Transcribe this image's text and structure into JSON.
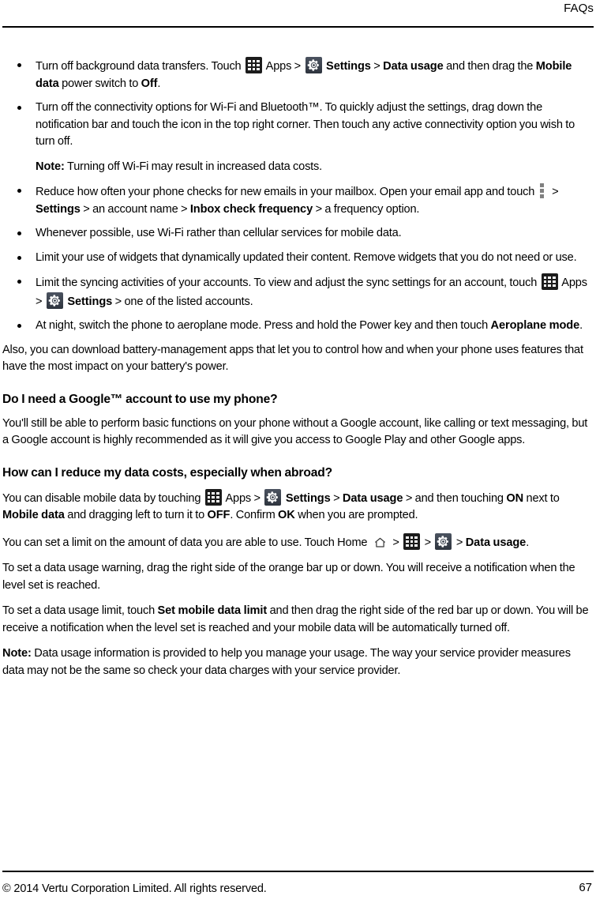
{
  "header": {
    "title": "FAQs"
  },
  "footer": {
    "copyright": "© 2014 Vertu Corporation Limited. All rights reserved.",
    "page_number": "67"
  },
  "icons": {
    "apps": "apps-grid-icon",
    "settings": "settings-gear-icon",
    "overflow": "overflow-menu-icon",
    "home": "home-icon"
  },
  "content": {
    "battery_tips": [
      {
        "id": "tip-background-data",
        "parts": [
          {
            "t": "text",
            "v": "Turn off background data transfers. Touch "
          },
          {
            "t": "icon",
            "v": "apps"
          },
          {
            "t": "text",
            "v": " Apps > "
          },
          {
            "t": "icon",
            "v": "settings"
          },
          {
            "t": "bold",
            "v": " Settings"
          },
          {
            "t": "text",
            "v": " > "
          },
          {
            "t": "bold",
            "v": "Data usage"
          },
          {
            "t": "text",
            "v": " and then drag the "
          },
          {
            "t": "bold",
            "v": "Mobile data"
          },
          {
            "t": "text",
            "v": " power switch to "
          },
          {
            "t": "bold",
            "v": "Off"
          },
          {
            "t": "text",
            "v": "."
          }
        ]
      },
      {
        "id": "tip-connectivity",
        "parts": [
          {
            "t": "text",
            "v": "Turn off the connectivity options for Wi-Fi and Bluetooth™. To quickly adjust the settings, drag down the notification bar and touch the icon in the top right corner. Then touch any active connectivity option you wish to turn off."
          }
        ],
        "note": {
          "label": "Note:",
          "text": " Turning off Wi-Fi may result in increased data costs."
        }
      },
      {
        "id": "tip-email-frequency",
        "parts": [
          {
            "t": "text",
            "v": "Reduce how often your phone checks for new emails in your mailbox. Open your email app and touch "
          },
          {
            "t": "icon",
            "v": "overflow"
          },
          {
            "t": "text",
            "v": " > "
          },
          {
            "t": "bold",
            "v": "Settings"
          },
          {
            "t": "text",
            "v": " > an account name > "
          },
          {
            "t": "bold",
            "v": "Inbox check frequency"
          },
          {
            "t": "text",
            "v": " > a frequency option."
          }
        ]
      },
      {
        "id": "tip-use-wifi",
        "parts": [
          {
            "t": "text",
            "v": "Whenever possible, use Wi-Fi rather than cellular services for mobile data."
          }
        ]
      },
      {
        "id": "tip-widgets",
        "parts": [
          {
            "t": "text",
            "v": "Limit your use of widgets that dynamically updated their content. Remove widgets that you do not need or use."
          }
        ]
      },
      {
        "id": "tip-syncing",
        "parts": [
          {
            "t": "text",
            "v": "Limit the syncing activities of your accounts. To view and adjust the sync settings for an account, touch "
          },
          {
            "t": "icon",
            "v": "apps"
          },
          {
            "t": "text",
            "v": " Apps > "
          },
          {
            "t": "icon",
            "v": "settings"
          },
          {
            "t": "bold",
            "v": " Settings"
          },
          {
            "t": "text",
            "v": " > one of the listed accounts."
          }
        ]
      },
      {
        "id": "tip-aeroplane",
        "parts": [
          {
            "t": "text",
            "v": "At night, switch the phone to aeroplane mode. Press and hold the Power key and then touch "
          },
          {
            "t": "bold",
            "v": "Aeroplane mode"
          },
          {
            "t": "text",
            "v": "."
          }
        ]
      }
    ],
    "battery_apps_paragraph": "Also, you can download battery-management apps that let you to control how and when your phone uses features that have the most impact on your battery's power.",
    "google_account": {
      "heading": "Do I need a Google™ account to use my phone?",
      "paragraph": "You'll still be able to perform basic functions on your phone without a Google account, like calling or text messaging, but a Google account is highly recommended as it will give you access to Google Play and other Google apps."
    },
    "data_costs": {
      "heading": "How can I reduce my data costs, especially when abroad?",
      "para1_parts": [
        {
          "t": "text",
          "v": "You can disable mobile data by touching "
        },
        {
          "t": "icon",
          "v": "apps"
        },
        {
          "t": "text",
          "v": " Apps > "
        },
        {
          "t": "icon",
          "v": "settings"
        },
        {
          "t": "bold",
          "v": " Settings"
        },
        {
          "t": "text",
          "v": " > "
        },
        {
          "t": "bold",
          "v": "Data usage"
        },
        {
          "t": "text",
          "v": " > and then touching "
        },
        {
          "t": "bold",
          "v": "ON"
        },
        {
          "t": "text",
          "v": " next to "
        },
        {
          "t": "bold",
          "v": "Mobile data"
        },
        {
          "t": "text",
          "v": " and dragging left to turn it to "
        },
        {
          "t": "bold",
          "v": "OFF"
        },
        {
          "t": "text",
          "v": ". Confirm "
        },
        {
          "t": "bold",
          "v": "OK"
        },
        {
          "t": "text",
          "v": " when you are prompted."
        }
      ],
      "para2_parts": [
        {
          "t": "text",
          "v": "You can set a limit on the amount of data you are able to use. Touch Home "
        },
        {
          "t": "icon",
          "v": "home"
        },
        {
          "t": "text",
          "v": " > "
        },
        {
          "t": "icon",
          "v": "apps"
        },
        {
          "t": "text",
          "v": " > "
        },
        {
          "t": "icon",
          "v": "settings"
        },
        {
          "t": "text",
          "v": " > "
        },
        {
          "t": "bold",
          "v": "Data usage"
        },
        {
          "t": "text",
          "v": "."
        }
      ],
      "para3": "To set a data usage warning, drag the right side of the orange bar up or down. You will receive a notification when the level set is reached.",
      "para4_parts": [
        {
          "t": "text",
          "v": "To set a data usage limit, touch "
        },
        {
          "t": "bold",
          "v": "Set mobile data limit"
        },
        {
          "t": "text",
          "v": " and then drag the right side of the red bar up or down. You will be receive a notification when the level set is reached and your mobile data will be automatically turned off."
        }
      ],
      "note": {
        "label": "Note:",
        "text": " Data usage information is provided to help you manage your usage. The way your service provider measures data may not be the same so check your data charges with your service provider."
      }
    }
  }
}
